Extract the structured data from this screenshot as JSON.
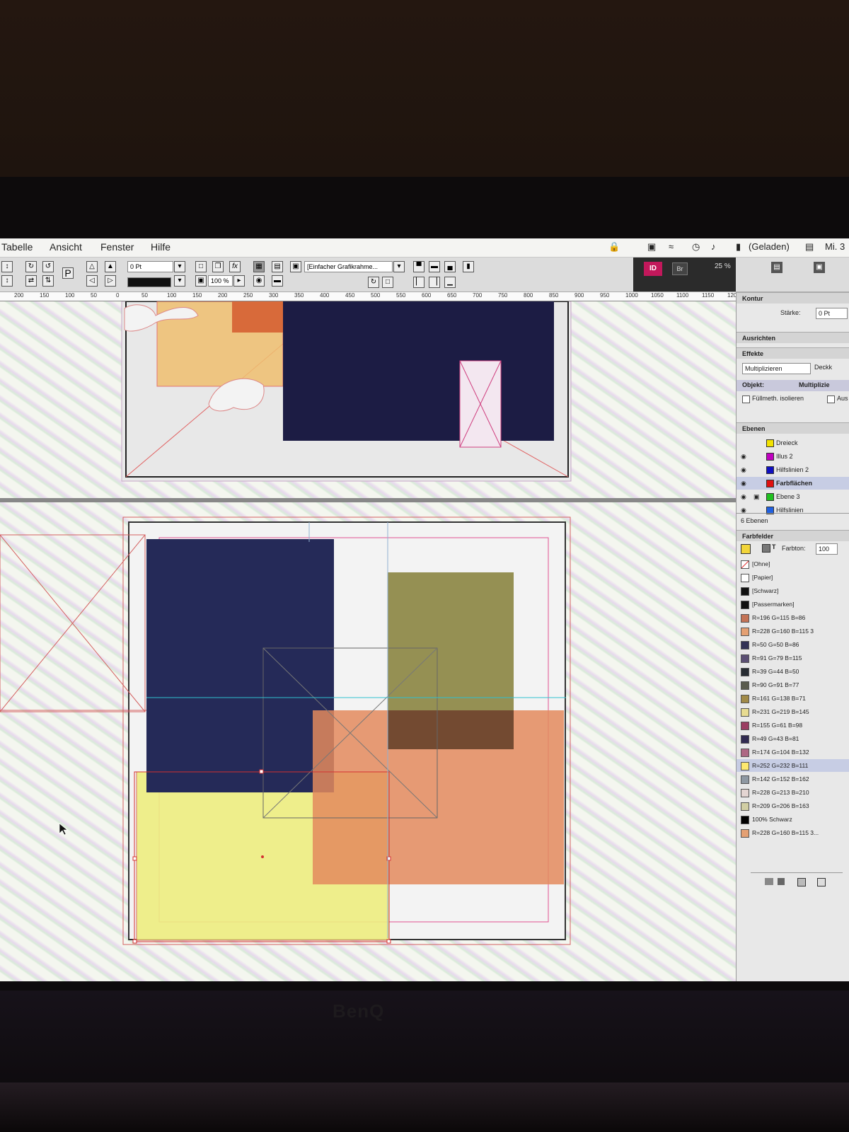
{
  "menubar": {
    "items": [
      "Tabelle",
      "Ansicht",
      "Fenster",
      "Hilfe"
    ],
    "battery_status": "(Geladen)",
    "clock": "Mi. 3"
  },
  "control_bar": {
    "stroke_weight": "0 Pt",
    "scale": "100 %",
    "object_style": "[Einfacher Grafikrahme...",
    "app_badge": "ID",
    "bridge_badge": "Br",
    "zoom": "25 %"
  },
  "ruler": {
    "ticks": [
      "200",
      "150",
      "100",
      "50",
      "0",
      "50",
      "100",
      "150",
      "200",
      "250",
      "300",
      "350",
      "400",
      "450",
      "500",
      "550",
      "600",
      "650",
      "700",
      "750",
      "800",
      "850",
      "900",
      "950",
      "1000",
      "1050",
      "1100",
      "1150",
      "1200"
    ]
  },
  "panels": {
    "kontur": {
      "title": "Kontur",
      "strength_label": "Stärke:",
      "strength_value": "0 Pt"
    },
    "ausrichten": {
      "title": "Ausrichten"
    },
    "effekte": {
      "title": "Effekte",
      "blend_mode": "Multiplizieren",
      "opacity_label": "Deckk",
      "object_label": "Objekt:",
      "object_value": "Multiplizie",
      "isolate_label": "Füllmeth. isolieren",
      "knockout_label": "Aus"
    },
    "ebenen": {
      "title": "Ebenen",
      "layers": [
        {
          "name": "Dreieck",
          "color": "#f2e200",
          "visible": false,
          "locked": false
        },
        {
          "name": "Illus 2",
          "color": "#c000c0",
          "visible": true,
          "locked": false
        },
        {
          "name": "Hilfslinien 2",
          "color": "#1010c0",
          "visible": true,
          "locked": false
        },
        {
          "name": "Farbflächen",
          "color": "#e01010",
          "visible": true,
          "locked": false,
          "selected": true
        },
        {
          "name": "Ebene 3",
          "color": "#20c020",
          "visible": true,
          "locked": true
        },
        {
          "name": "Hilfslinien",
          "color": "#2060e0",
          "visible": true,
          "locked": false
        }
      ],
      "count": "6 Ebenen"
    },
    "farbfelder": {
      "title": "Farbfelder",
      "tint_label": "Farbton:",
      "tint_value": "100",
      "swatches": [
        {
          "name": "[Ohne]",
          "color": "none"
        },
        {
          "name": "[Papier]",
          "color": "#ffffff"
        },
        {
          "name": "[Schwarz]",
          "color": "#111111"
        },
        {
          "name": "[Passermarken]",
          "color": "#111111"
        },
        {
          "name": "R=196 G=115 B=86",
          "color": "#c47356"
        },
        {
          "name": "R=228 G=160 B=115 3",
          "color": "#e4a073"
        },
        {
          "name": "R=50 G=50 B=86",
          "color": "#323256"
        },
        {
          "name": "R=91 G=79 B=115",
          "color": "#5b4f73"
        },
        {
          "name": "R=39 G=44 B=50",
          "color": "#272c32"
        },
        {
          "name": "R=90 G=91 B=77",
          "color": "#5a5b4d"
        },
        {
          "name": "R=161 G=138 B=71",
          "color": "#a18a47"
        },
        {
          "name": "R=231 G=219 B=145",
          "color": "#e7db91"
        },
        {
          "name": "R=155 G=61 B=98",
          "color": "#9b3d62"
        },
        {
          "name": "R=49 G=43 B=81",
          "color": "#312b51"
        },
        {
          "name": "R=174 G=104 B=132",
          "color": "#ae6884"
        },
        {
          "name": "R=252 G=232 B=111",
          "color": "#fce86f",
          "selected": true
        },
        {
          "name": "R=142 G=152 B=162",
          "color": "#8e98a2"
        },
        {
          "name": "R=228 G=213 B=210",
          "color": "#e4d5d2"
        },
        {
          "name": "R=209 G=206 B=163",
          "color": "#d1cea3"
        },
        {
          "name": "100% Schwarz",
          "color": "#000000"
        },
        {
          "name": "R=228 G=160 B=115 3...",
          "color": "#e4a073"
        }
      ]
    }
  },
  "device": {
    "brand": "BenQ"
  }
}
